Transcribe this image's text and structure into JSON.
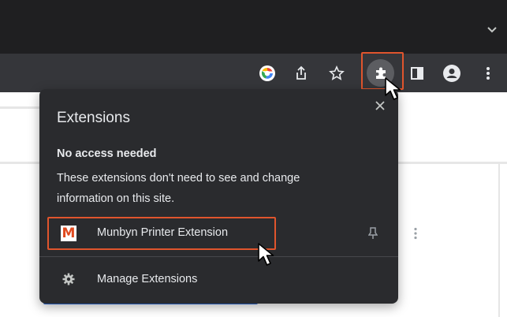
{
  "toolbar": {
    "icons": [
      "google-icon",
      "share-icon",
      "bookmark-star-icon",
      "extensions-puzzle-icon",
      "side-panel-icon",
      "profile-icon",
      "more-vert-icon"
    ]
  },
  "popup": {
    "title": "Extensions",
    "section_heading": "No access needed",
    "section_desc_line1": "These extensions don't need to see and change",
    "section_desc_line2": "information on this site.",
    "extension": {
      "logo_letter": "M",
      "name": "Munbyn Printer Extension"
    },
    "manage_label": "Manage Extensions"
  },
  "colors": {
    "highlight": "#e0552d",
    "popup_bg": "#2a2b2e",
    "toolbar_bg": "#35363a"
  }
}
